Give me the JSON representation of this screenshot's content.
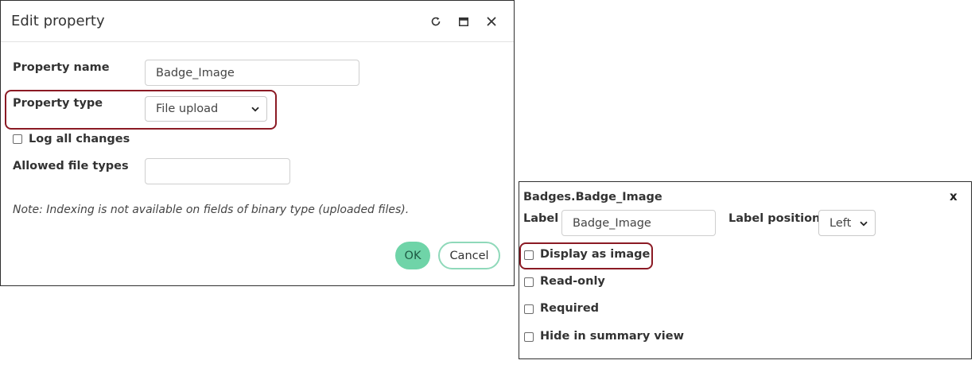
{
  "dialog": {
    "title": "Edit property",
    "icons": {
      "refresh": "refresh-icon",
      "maximize": "maximize-icon",
      "close": "close-icon"
    },
    "property_name": {
      "label": "Property name",
      "value": "Badge_Image"
    },
    "property_type": {
      "label": "Property type",
      "value": "File upload"
    },
    "log_changes": {
      "label": "Log all changes",
      "checked": false
    },
    "allowed_file_types": {
      "label": "Allowed file types",
      "value": ""
    },
    "note": "Note: Indexing is not available on fields of binary type (uploaded files).",
    "ok_label": "OK",
    "cancel_label": "Cancel"
  },
  "panel": {
    "title": "Badges.Badge_Image",
    "close_label": "x",
    "label_field": {
      "label": "Label",
      "value": "Badge_Image"
    },
    "label_position": {
      "label": "Label position",
      "value": "Left"
    },
    "options": [
      {
        "label": "Display as image",
        "checked": false
      },
      {
        "label": "Read-only",
        "checked": false
      },
      {
        "label": "Required",
        "checked": false
      },
      {
        "label": "Hide in summary view",
        "checked": false
      }
    ]
  },
  "colors": {
    "highlight": "#8b1a24",
    "ok_button": "#6fd4a8",
    "cancel_border": "#8fd9ba"
  }
}
